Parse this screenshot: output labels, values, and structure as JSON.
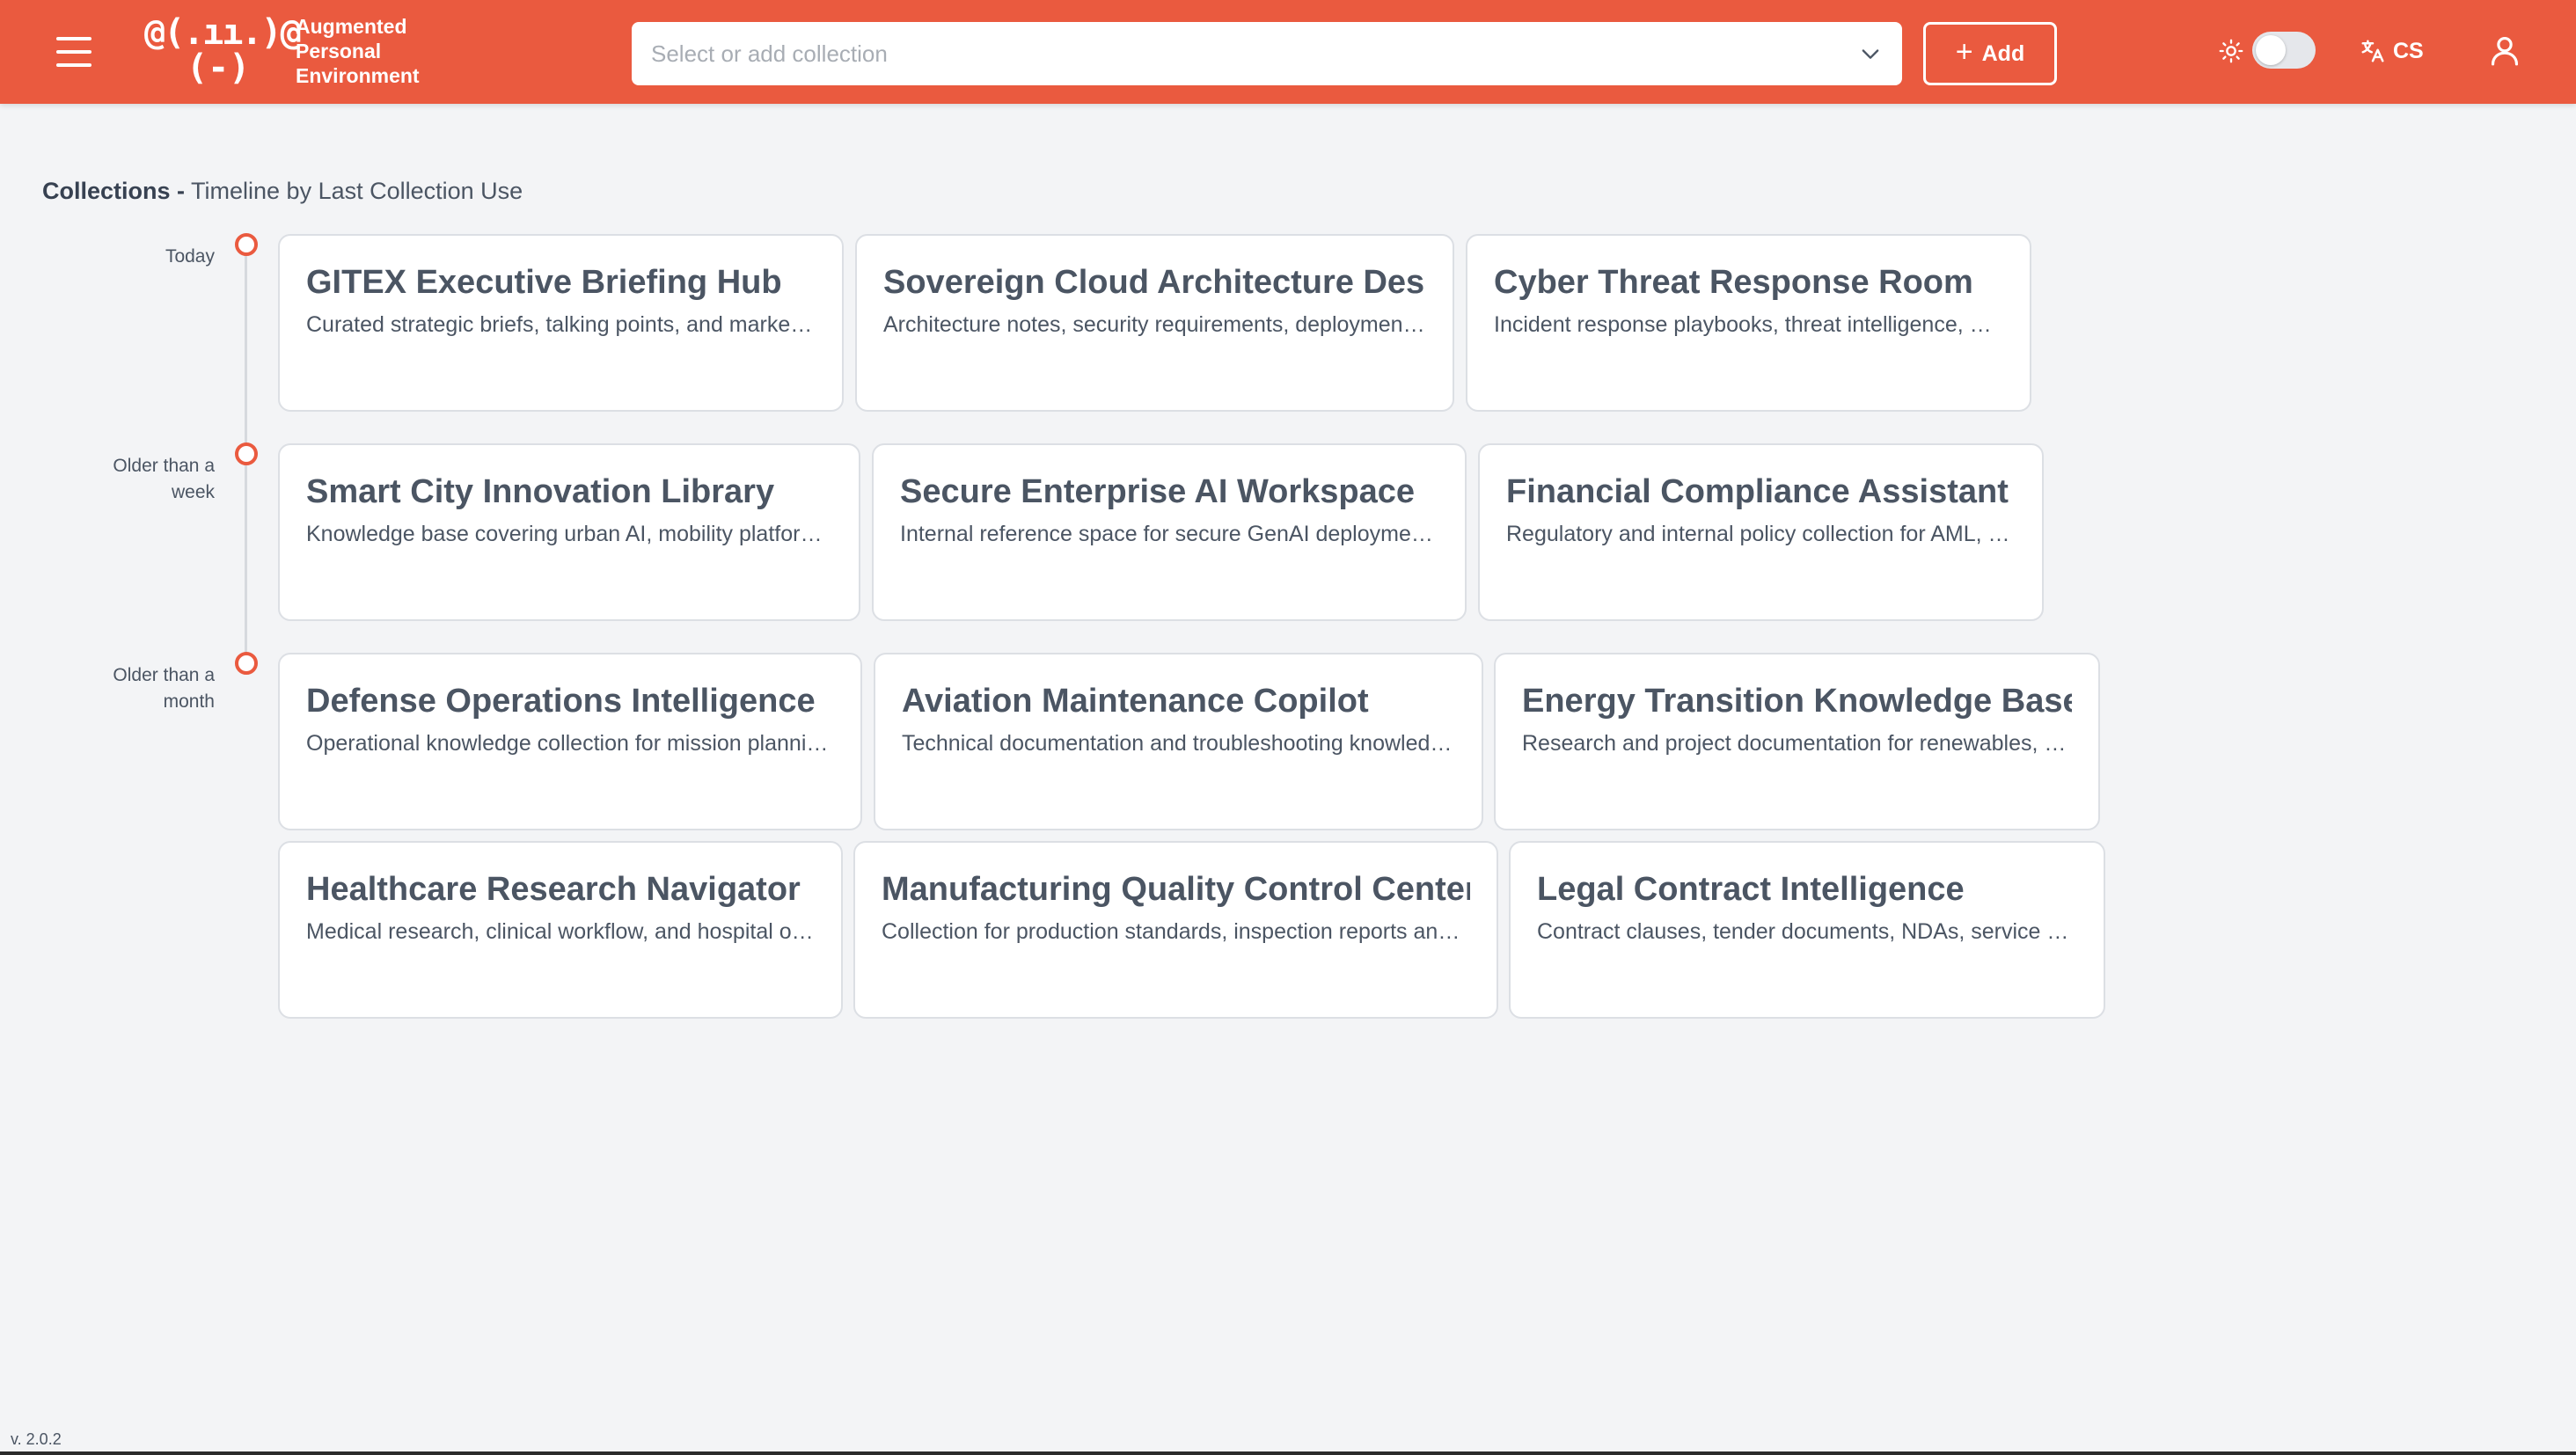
{
  "header": {
    "logo_line1": "@(.ıı.)@",
    "logo_line2": "(-)",
    "brand": [
      "Augmented",
      "Personal",
      "Environment"
    ],
    "collection_select_placeholder": "Select or add collection",
    "add_label": "Add",
    "language": "CS",
    "theme_dark_enabled": false,
    "accent_color": "#ea5a3f"
  },
  "page": {
    "title_bold": "Collections -",
    "title_rest": " Timeline by Last Collection Use"
  },
  "timeline": [
    {
      "label": [
        "Today"
      ],
      "cards": [
        {
          "title": "GITEX Executive Briefing Hub",
          "description": "Curated strategic briefs, talking points, and market insights"
        },
        {
          "title": "Sovereign Cloud Architecture Desk",
          "description": "Architecture notes, security requirements, deployment patterns"
        },
        {
          "title": "Cyber Threat Response Room",
          "description": "Incident response playbooks, threat intelligence, and escalation"
        }
      ]
    },
    {
      "label": [
        "Older than a",
        "week"
      ],
      "cards": [
        {
          "title": "Smart City Innovation Library",
          "description": "Knowledge base covering urban AI, mobility platforms, and services"
        },
        {
          "title": "Secure Enterprise AI Workspace",
          "description": "Internal reference space for secure GenAI deployment and governance"
        },
        {
          "title": "Financial Compliance Assistant",
          "description": "Regulatory and internal policy collection for AML, KYC and reporting"
        }
      ]
    },
    {
      "label": [
        "Older than a",
        "month"
      ],
      "cards": [
        {
          "title": "Defense Operations Intelligence",
          "description": "Operational knowledge collection for mission planning and logistics"
        },
        {
          "title": "Aviation Maintenance Copilot",
          "description": "Technical documentation and troubleshooting knowledge for fleets"
        },
        {
          "title": "Energy Transition Knowledge Base",
          "description": "Research and project documentation for renewables, storage and grids"
        },
        {
          "title": "Healthcare Research Navigator",
          "description": "Medical research, clinical workflow, and hospital operations"
        },
        {
          "title": "Manufacturing Quality Control Center",
          "description": "Collection for production standards, inspection reports and audits"
        },
        {
          "title": "Legal Contract Intelligence",
          "description": "Contract clauses, tender documents, NDAs, service agreements"
        }
      ]
    }
  ],
  "version": "v. 2.0.2"
}
